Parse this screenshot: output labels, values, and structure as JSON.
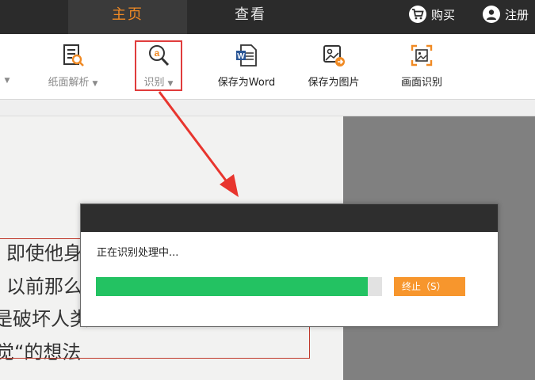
{
  "topbar": {
    "tabs": [
      {
        "label": "主页",
        "active": true
      },
      {
        "label": "查看",
        "active": false
      }
    ],
    "buy_label": "购买",
    "register_label": "注册",
    "accent_color": "#f08a24"
  },
  "ribbon": {
    "items": [
      {
        "label": "纸面解析",
        "icon": "page-analysis-icon",
        "dropdown": true
      },
      {
        "label": "识别",
        "icon": "ocr-magnifier-icon",
        "dropdown": true
      },
      {
        "label": "保存为Word",
        "icon": "word-document-icon",
        "dropdown": false
      },
      {
        "label": "保存为图片",
        "icon": "save-image-icon",
        "dropdown": false
      },
      {
        "label": "画面识别",
        "icon": "screen-capture-icon",
        "dropdown": false
      }
    ]
  },
  "document": {
    "lines": [
      "即使他身",
      "以前那么",
      "是破坏人类",
      "觉“的想法"
    ]
  },
  "dialog": {
    "message": "正在识别处理中...",
    "progress_percent": 95,
    "stop_label": "终止（S）"
  }
}
